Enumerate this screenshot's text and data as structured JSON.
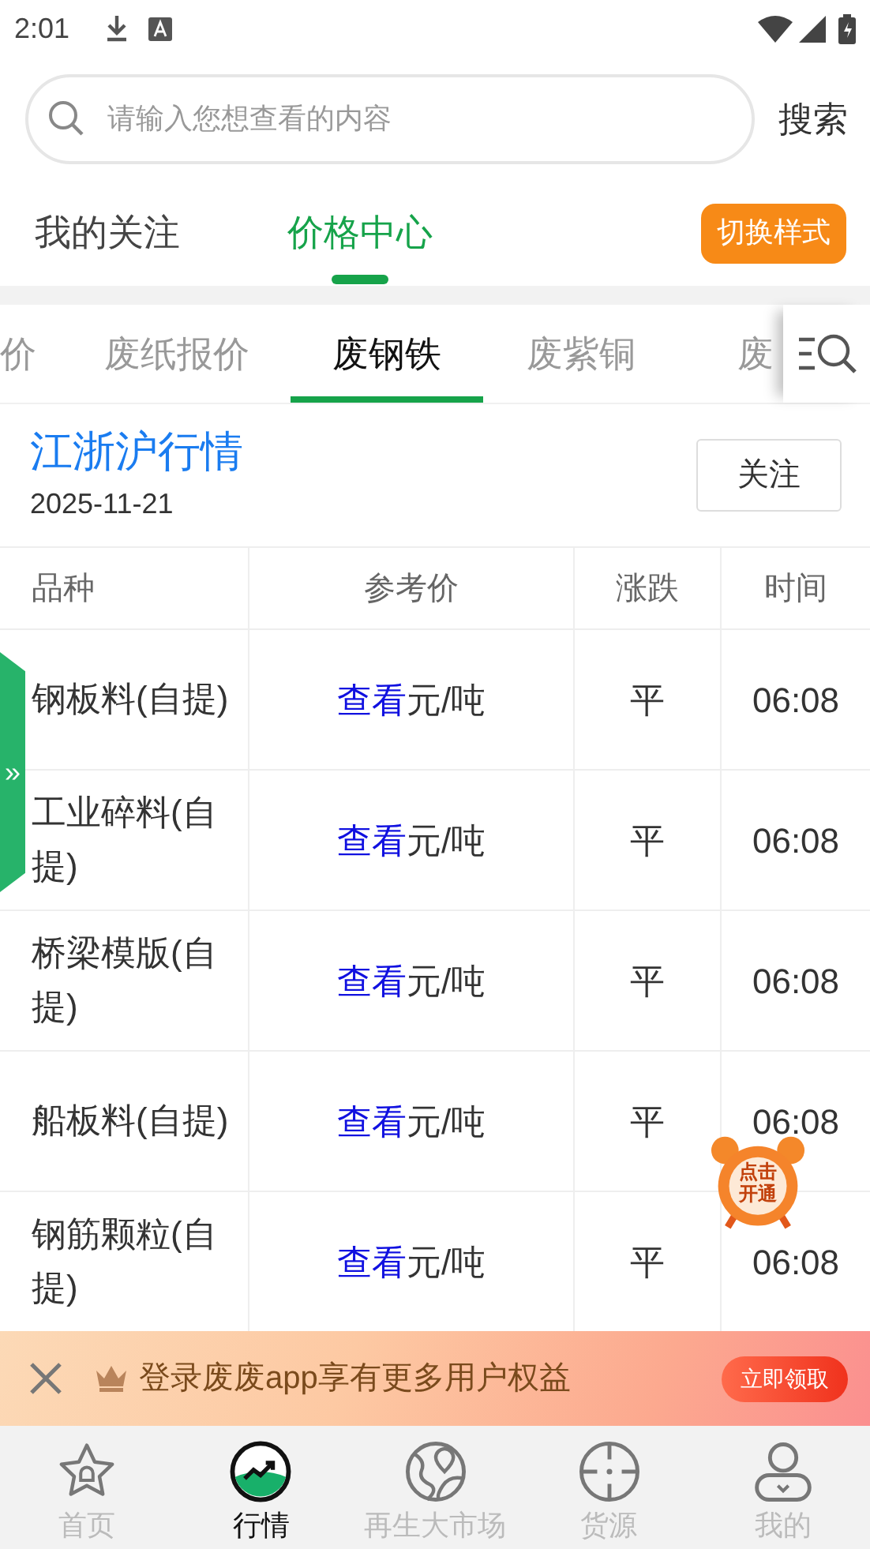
{
  "status_bar": {
    "time": "2:01"
  },
  "search": {
    "placeholder": "请输入您想查看的内容",
    "button": "搜索"
  },
  "top_tabs": [
    {
      "label": "我的关注",
      "selected": false
    },
    {
      "label": "价格中心",
      "selected": true
    }
  ],
  "switch_style_button": "切换样式",
  "category_tabs": [
    {
      "label": "价",
      "selected": false
    },
    {
      "label": "废纸报价",
      "selected": false
    },
    {
      "label": "废钢铁",
      "selected": true
    },
    {
      "label": "废紫铜",
      "selected": false
    },
    {
      "label": "废",
      "selected": false
    }
  ],
  "section": {
    "title": "江浙沪行情",
    "date": "2025-11-21",
    "follow_button": "关注"
  },
  "table": {
    "columns": [
      "品种",
      "参考价",
      "涨跌",
      "时间"
    ],
    "rows": [
      {
        "name": "钢板料(自提)",
        "link": "查看",
        "unit": "元/吨",
        "change": "平",
        "time": "06:08"
      },
      {
        "name": "工业碎料(自提)",
        "link": "查看",
        "unit": "元/吨",
        "change": "平",
        "time": "06:08"
      },
      {
        "name": "桥梁模版(自提)",
        "link": "查看",
        "unit": "元/吨",
        "change": "平",
        "time": "06:08"
      },
      {
        "name": "船板料(自提)",
        "link": "查看",
        "unit": "元/吨",
        "change": "平",
        "time": "06:08"
      },
      {
        "name": "钢筋颗粒(自提)",
        "link": "查看",
        "unit": "元/吨",
        "change": "平",
        "time": "06:08"
      }
    ]
  },
  "side_tab": "»",
  "alarm_badge": "点击开通",
  "banner": {
    "text": "登录废废app享有更多用户权益",
    "button": "立即领取"
  },
  "bottom_nav": [
    {
      "label": "首页",
      "selected": false
    },
    {
      "label": "行情",
      "selected": true
    },
    {
      "label": "再生大市场",
      "selected": false
    },
    {
      "label": "货源",
      "selected": false
    },
    {
      "label": "我的",
      "selected": false
    }
  ]
}
